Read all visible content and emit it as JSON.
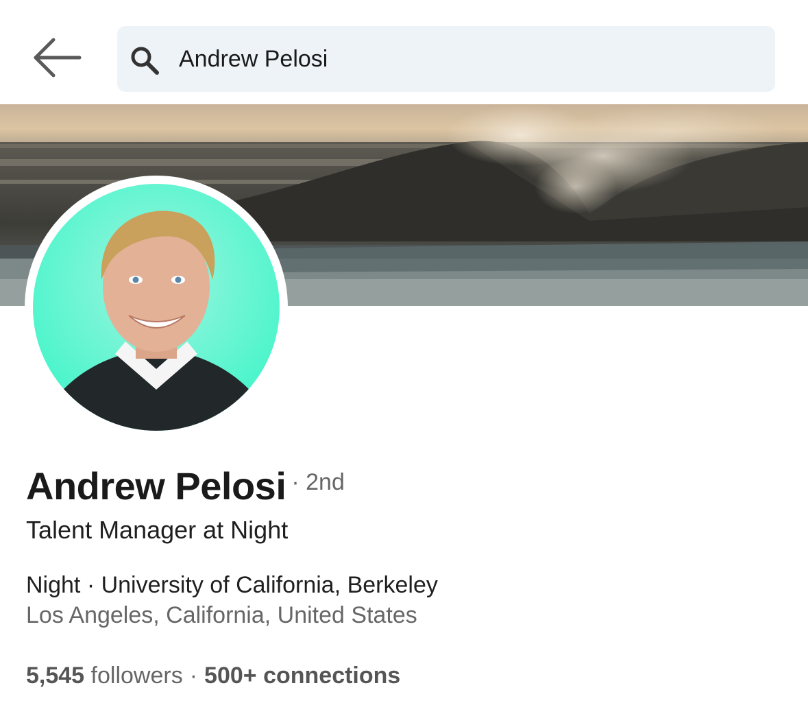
{
  "search": {
    "value": "Andrew Pelosi",
    "icon": "search-icon"
  },
  "nav": {
    "back_icon": "back-arrow-icon"
  },
  "profile": {
    "name": "Andrew Pelosi",
    "degree": "· 2nd",
    "headline": "Talent Manager at Night",
    "company_education": "Night · University of California, Berkeley",
    "location": "Los Angeles, California, United States",
    "followers_count": "5,545",
    "followers_label": "followers",
    "separator": "·",
    "connections": "500+ connections"
  },
  "colors": {
    "search_bg": "#eef3f8",
    "avatar_bg": "#3ff5c8",
    "secondary_text": "#666666"
  }
}
